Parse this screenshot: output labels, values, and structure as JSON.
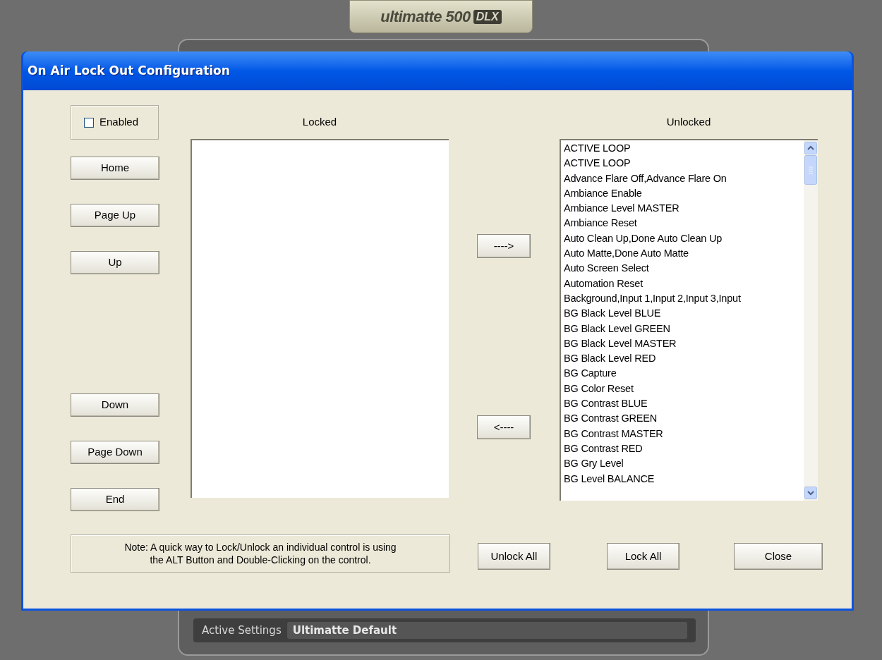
{
  "background_app": {
    "logo": {
      "brand": "ultimatte 500",
      "badge": "DLX"
    },
    "active_settings": {
      "label": "Active Settings",
      "value": "Ultimatte Default"
    }
  },
  "dialog": {
    "title": "On Air Lock Out Configuration",
    "enabled": {
      "label": "Enabled",
      "checked": false
    },
    "nav_buttons_top": [
      "Home",
      "Page Up",
      "Up"
    ],
    "nav_buttons_bottom": [
      "Down",
      "Page Down",
      "End"
    ],
    "locked": {
      "heading": "Locked"
    },
    "move_buttons": [
      "---->",
      "<----"
    ],
    "unlocked": {
      "heading": "Unlocked",
      "items": [
        "ACTIVE LOOP",
        "ACTIVE LOOP",
        "Advance Flare Off,Advance Flare On",
        "Ambiance Enable",
        "Ambiance Level MASTER",
        "Ambiance Reset",
        "Auto Clean Up,Done Auto Clean Up",
        "Auto Matte,Done Auto Matte",
        "Auto Screen Select",
        "Automation Reset",
        "Background,Input 1,Input 2,Input 3,Input",
        "BG Black Level BLUE",
        "BG Black Level GREEN",
        "BG Black Level MASTER",
        "BG Black Level RED",
        "BG Capture",
        "BG Color Reset",
        "BG Contrast BLUE",
        "BG Contrast GREEN",
        "BG Contrast MASTER",
        "BG Contrast RED",
        "BG Gry Level",
        "BG Level BALANCE"
      ]
    },
    "note": "Note: A quick way to Lock/Unlock an individual control is using\nthe ALT Button and Double-Clicking on the control.",
    "buttons": [
      "Unlock All",
      "Lock All",
      "Close"
    ]
  }
}
